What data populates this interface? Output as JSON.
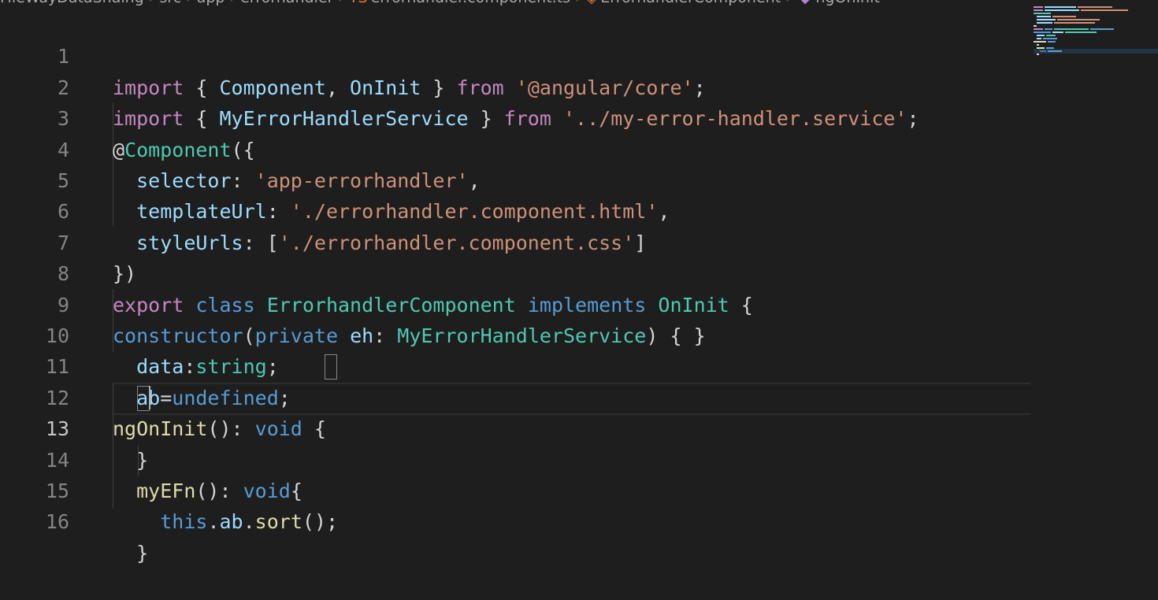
{
  "breadcrumb": {
    "segments": [
      "FileWayDataShaing",
      "src",
      "app",
      "errorhandler",
      "errorhandler.component.ts",
      "ErrorhandlerComponent",
      "ngOnInit"
    ]
  },
  "editor": {
    "active_line": 13,
    "lines": [
      {
        "num": "1"
      },
      {
        "num": "2"
      },
      {
        "num": "3"
      },
      {
        "num": "4"
      },
      {
        "num": "5"
      },
      {
        "num": "6"
      },
      {
        "num": "7"
      },
      {
        "num": "8"
      },
      {
        "num": "9"
      },
      {
        "num": "10"
      },
      {
        "num": "11"
      },
      {
        "num": "12"
      },
      {
        "num": "13"
      },
      {
        "num": "14"
      },
      {
        "num": "15"
      },
      {
        "num": "16"
      }
    ],
    "tokens": {
      "l1": [
        "import",
        " { ",
        "Component",
        ", ",
        "OnInit",
        " } ",
        "from",
        " ",
        "'@angular/core'",
        ";"
      ],
      "l2": [
        "import",
        " { ",
        "MyErrorHandlerService",
        " } ",
        "from",
        " ",
        "'../my-error-handler.service'",
        ";"
      ],
      "l3": [
        "@",
        "Component",
        "({"
      ],
      "l4": [
        "  ",
        "selector",
        ": ",
        "'app-errorhandler'",
        ","
      ],
      "l5": [
        "  ",
        "templateUrl",
        ": ",
        "'./errorhandler.component.html'",
        ","
      ],
      "l6": [
        "  ",
        "styleUrls",
        ": [",
        "'./errorhandler.component.css'",
        "]"
      ],
      "l7": [
        "})"
      ],
      "l8": [
        "export",
        " ",
        "class",
        " ",
        "ErrorhandlerComponent",
        " ",
        "implements",
        " ",
        "OnInit",
        " {"
      ],
      "l9": [
        "constructor",
        "(",
        "private",
        " ",
        "eh",
        ": ",
        "MyErrorHandlerService",
        ") { }"
      ],
      "l10": [
        "  ",
        "data",
        ":",
        "string",
        ";"
      ],
      "l11": [
        "  ",
        "ab",
        "=",
        "undefined",
        ";"
      ],
      "l12": [
        "ngOnInit",
        "(): ",
        "void",
        " {"
      ],
      "l13": [
        "  ",
        "}"
      ],
      "l14": [
        "  ",
        "myEFn",
        "(): ",
        "void",
        "{"
      ],
      "l15": [
        "    ",
        "this",
        ".",
        "ab",
        ".",
        "sort",
        "();"
      ],
      "l16": [
        "  ",
        "}"
      ]
    }
  },
  "colors": {
    "background": "#1e1e1e",
    "keyword_control": "#c586c0",
    "keyword": "#569cd6",
    "type": "#4ec9b0",
    "variable": "#9cdcfe",
    "string": "#ce9178",
    "function": "#dcdcaa",
    "plain": "#d4d4d4"
  }
}
